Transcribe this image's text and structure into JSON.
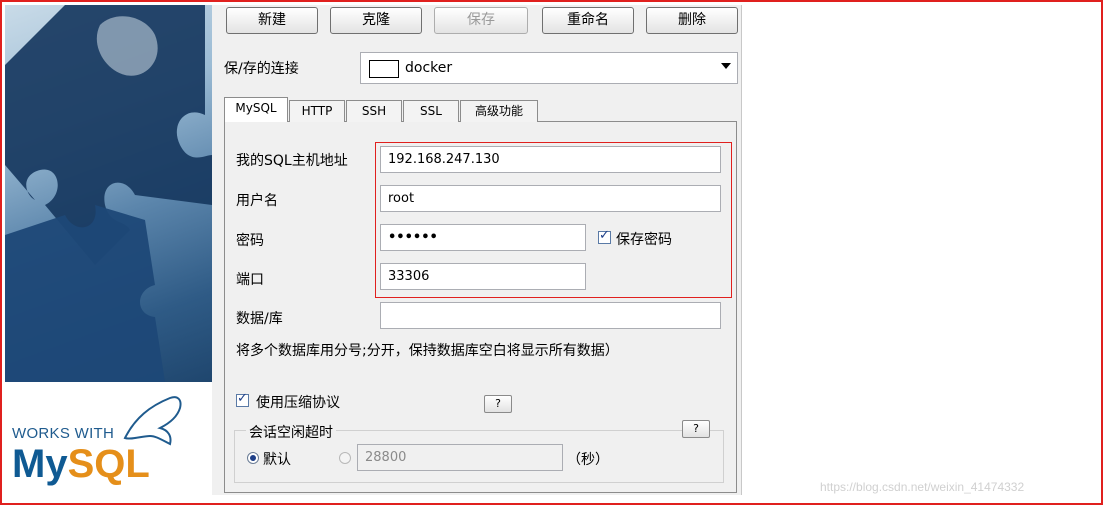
{
  "toolbar": {
    "new": "新建",
    "clone": "克隆",
    "save": "保存",
    "rename": "重命名",
    "delete": "删除"
  },
  "saved_connection": {
    "label": "保/存的连接",
    "value": "docker"
  },
  "tabs": [
    "MySQL",
    "HTTP",
    "SSH",
    "SSL",
    "高级功能"
  ],
  "form": {
    "host_label": "我的SQL主机地址",
    "host_value": "192.168.247.130",
    "user_label": "用户名",
    "user_value": "root",
    "password_label": "密码",
    "password_value": "••••••",
    "save_password_label": "保存密码",
    "port_label": "端口",
    "port_value": "33306",
    "database_label": "数据/库",
    "database_value": "",
    "database_hint": "将多个数据库用分号;分开，保持数据库空白将显示所有数据）",
    "compression_label": "使用压缩协议",
    "help_label": "?",
    "session_timeout_label": "会话空闲超时",
    "default_label": "默认",
    "timeout_value": "28800",
    "seconds_label": "（秒）"
  },
  "branding": {
    "works_with": "WORKS WITH",
    "mysql_my": "My",
    "mysql_sql": "SQL"
  },
  "watermark": "https://blog.csdn.net/weixin_41474332",
  "colors": {
    "highlight": "#e0201e",
    "mysql_blue": "#0f5a93",
    "mysql_orange": "#e58f1a"
  }
}
